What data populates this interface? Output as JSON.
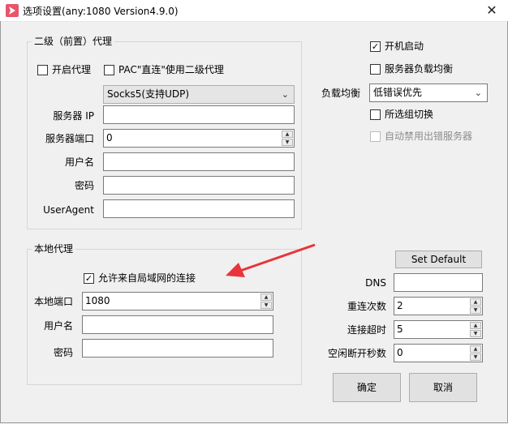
{
  "window": {
    "title": "选项设置(any:1080 Version4.9.0)",
    "close_glyph": "✕"
  },
  "proxy2": {
    "group_title": "二级（前置）代理",
    "enable_label": "开启代理",
    "enable_checked": false,
    "pac_label": "PAC\"直连\"使用二级代理",
    "pac_checked": false,
    "type_selected": "Socks5(支持UDP)",
    "server_ip_label": "服务器 IP",
    "server_ip_value": "",
    "server_port_label": "服务器端口",
    "server_port_value": "0",
    "username_label": "用户名",
    "username_value": "",
    "password_label": "密码",
    "password_value": "",
    "useragent_label": "UserAgent",
    "useragent_value": ""
  },
  "right": {
    "autostart_label": "开机启动",
    "autostart_checked": true,
    "loadbalance_label": "服务器负载均衡",
    "loadbalance_checked": false,
    "balance_label": "负载均衡",
    "balance_selected": "低错误优先",
    "group_switch_label": "所选组切换",
    "group_switch_checked": false,
    "auto_disable_label": "自动禁用出错服务器",
    "auto_disable_checked": false
  },
  "local": {
    "group_title": "本地代理",
    "allow_lan_label": "允许来自局域网的连接",
    "allow_lan_checked": true,
    "port_label": "本地端口",
    "port_value": "1080",
    "username_label": "用户名",
    "username_value": "",
    "password_label": "密码",
    "password_value": ""
  },
  "advanced": {
    "set_default_label": "Set Default",
    "dns_label": "DNS",
    "dns_value": "",
    "retry_label": "重连次数",
    "retry_value": "2",
    "timeout_label": "连接超时",
    "timeout_value": "5",
    "idle_label": "空闲断开秒数",
    "idle_value": "0"
  },
  "buttons": {
    "ok_label": "确定",
    "cancel_label": "取消"
  },
  "colors": {
    "arrow": "#e8343a",
    "app_icon": "#e8556a"
  }
}
